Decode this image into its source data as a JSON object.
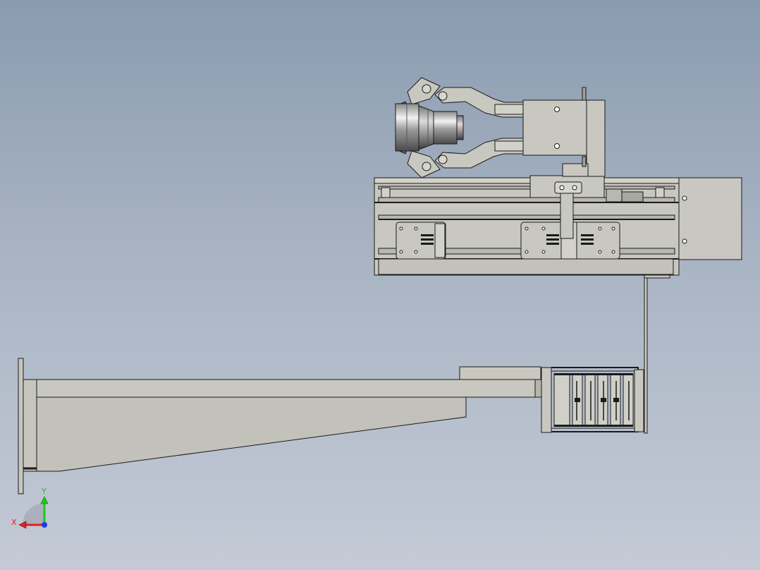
{
  "triad": {
    "x_label": "X",
    "y_label": "Y",
    "x_color": "#e02020",
    "y_color": "#1ec81e",
    "z_color": "#1e3cdc"
  },
  "colors": {
    "part_fill": "#c6c6be",
    "part_fill_light": "#d4d4cc",
    "edge": "#1a1a1a",
    "metal_dark": "#6b6b6b",
    "metal_light": "#e8e8e8"
  },
  "parts": {
    "wall_bracket": "wall-mount-cantilever-arm",
    "linear_module": "linear-slide-module",
    "gripper": "pneumatic-gripper",
    "workpiece": "cylindrical-workpiece",
    "cable_chain": "cable-drag-chain"
  }
}
